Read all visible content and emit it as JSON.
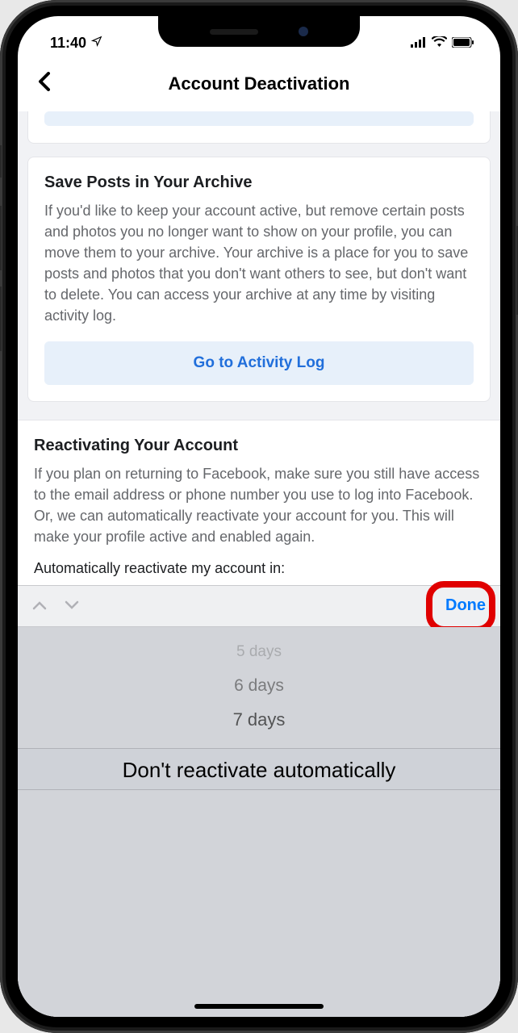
{
  "status": {
    "time": "11:40"
  },
  "header": {
    "title": "Account Deactivation"
  },
  "archive_card": {
    "title": "Save Posts in Your Archive",
    "text": "If you'd like to keep your account active, but remove certain posts and photos you no longer want to show on your profile, you can move them to your archive. Your archive is a place for you to save posts and photos that you don't want others to see, but don't want to delete. You can access your archive at any time by visiting activity log.",
    "button": "Go to Activity Log"
  },
  "reactivate_section": {
    "title": "Reactivating Your Account",
    "text": "If you plan on returning to Facebook, make sure you still have access to the email address or phone number you use to log into Facebook. Or, we can automatically reactivate your account for you. This will make your profile active and enabled again.",
    "prompt": "Automatically reactivate my account in:"
  },
  "picker": {
    "done": "Done",
    "options": [
      "5 days",
      "6 days",
      "7 days"
    ],
    "selected": "Don't reactivate automatically"
  }
}
